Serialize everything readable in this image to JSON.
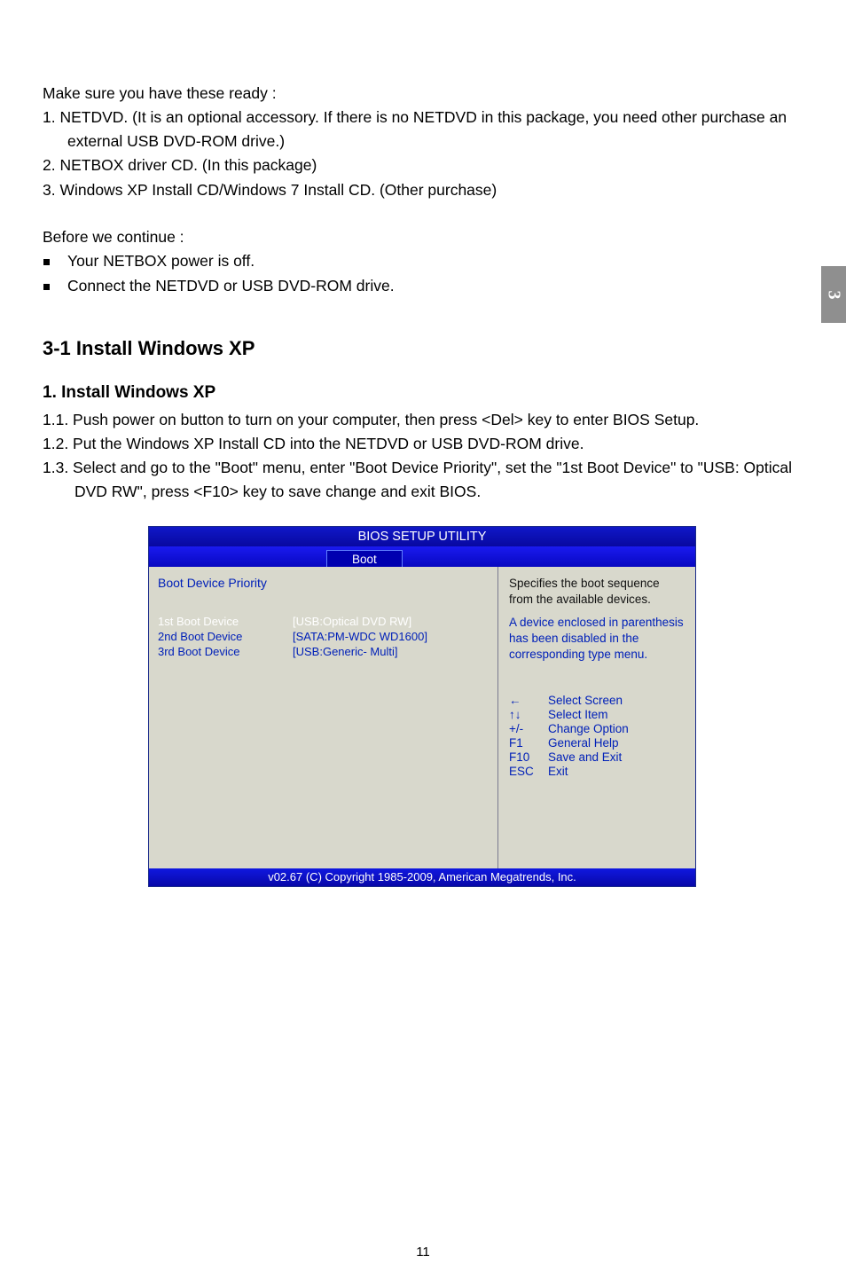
{
  "side_tab": "3",
  "intro": {
    "lead": "Make sure you have these ready :",
    "items": [
      "1. NETDVD. (It is an optional accessory. If there is no NETDVD in this package, you need other purchase an external USB DVD-ROM drive.)",
      "2. NETBOX driver CD. (In this package)",
      "3. Windows XP Install CD/Windows 7 Install CD. (Other purchase)"
    ]
  },
  "before": {
    "lead": "Before we continue :",
    "bullets": [
      "Your NETBOX power is off.",
      "Connect the NETDVD or USB DVD-ROM drive."
    ]
  },
  "section_heading": "3-1 Install Windows XP",
  "sub_heading": "1. Install Windows XP",
  "steps": [
    "1.1.  Push power on button to turn on your computer, then press <Del> key to enter BIOS Setup.",
    "1.2.  Put the Windows XP Install CD into the NETDVD or USB DVD-ROM drive.",
    "1.3.  Select and go to the \"Boot\" menu, enter \"Boot Device Priority\", set the \"1st Boot Device\" to \"USB: Optical DVD RW\", press <F10> key to save change and exit BIOS."
  ],
  "bios": {
    "title": "BIOS SETUP UTILITY",
    "tab": "Boot",
    "panel_heading": "Boot Device Priority",
    "rows": [
      {
        "label": "1st Boot Device",
        "value": "[USB:Optical DVD RW]",
        "selected": true
      },
      {
        "label": "2nd Boot Device",
        "value": "[SATA:PM-WDC WD1600]",
        "selected": false
      },
      {
        "label": "3rd Boot Device",
        "value": "[USB:Generic- Multi]",
        "selected": false
      }
    ],
    "help_top_black": "Specifies the boot sequence from the available devices.",
    "help_blue": "A device enclosed in parenthesis has been disabled in the corresponding type menu.",
    "keys": [
      {
        "k": "←",
        "d": "Select Screen"
      },
      {
        "k": "↑↓",
        "d": "Select Item"
      },
      {
        "k": "+/-",
        "d": "Change Option"
      },
      {
        "k": "F1",
        "d": "General Help"
      },
      {
        "k": "F10",
        "d": "Save and Exit"
      },
      {
        "k": "ESC",
        "d": "Exit"
      }
    ],
    "footer": "v02.67 (C) Copyright 1985-2009, American Megatrends, Inc."
  },
  "page_number": "11"
}
